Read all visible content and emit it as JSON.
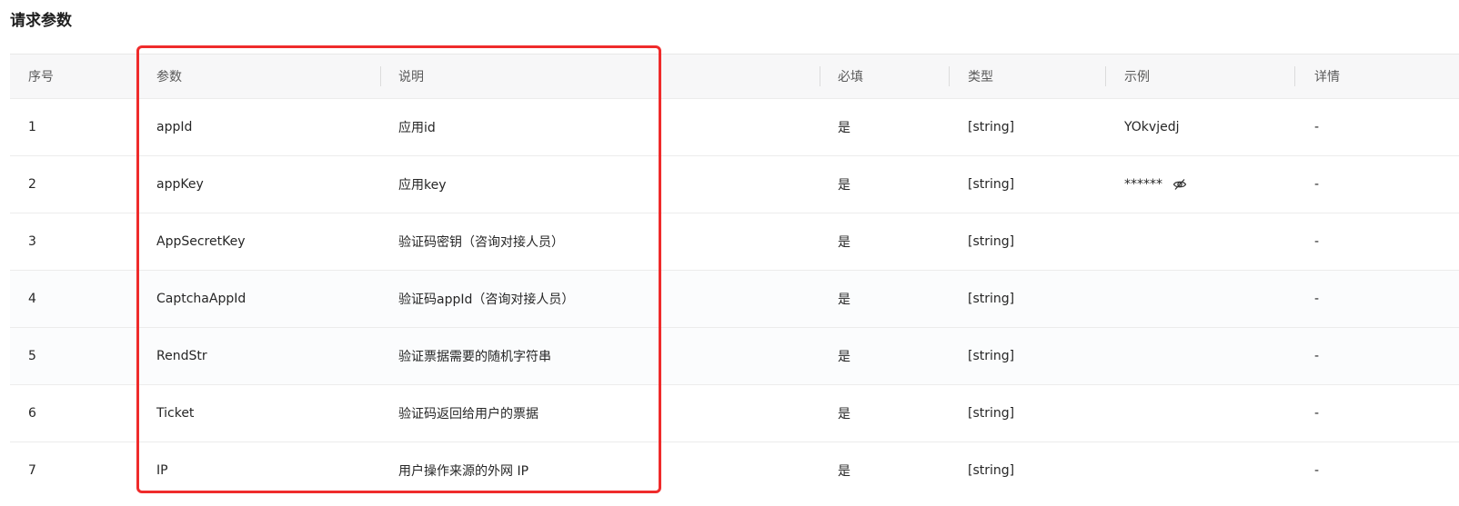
{
  "section_title": "请求参数",
  "table": {
    "headers": [
      "序号",
      "参数",
      "说明",
      "必填",
      "类型",
      "示例",
      "详情"
    ],
    "rows": [
      {
        "index": "1",
        "param": "appId",
        "desc": "应用id",
        "required": "是",
        "type": "[string]",
        "example": "YOkvjedj",
        "detail": "-"
      },
      {
        "index": "2",
        "param": "appKey",
        "desc": "应用key",
        "required": "是",
        "type": "[string]",
        "example": "******",
        "detail": "-"
      },
      {
        "index": "3",
        "param": "AppSecretKey",
        "desc": "验证码密钥（咨询对接人员）",
        "required": "是",
        "type": "[string]",
        "example": "",
        "detail": "-"
      },
      {
        "index": "4",
        "param": "CaptchaAppId",
        "desc": "验证码appId（咨询对接人员）",
        "required": "是",
        "type": "[string]",
        "example": "",
        "detail": "-"
      },
      {
        "index": "5",
        "param": "RendStr",
        "desc": "验证票据需要的随机字符串",
        "required": "是",
        "type": "[string]",
        "example": "",
        "detail": "-"
      },
      {
        "index": "6",
        "param": "Ticket",
        "desc": "验证码返回给用户的票据",
        "required": "是",
        "type": "[string]",
        "example": "",
        "detail": "-"
      },
      {
        "index": "7",
        "param": "IP",
        "desc": "用户操作来源的外网 IP",
        "required": "是",
        "type": "[string]",
        "example": "",
        "detail": "-"
      }
    ]
  },
  "icons": {
    "masked_value_toggle": "eye-off-icon"
  },
  "colors": {
    "highlight_border": "#ef2b2b",
    "header_bg": "#f7f7f8",
    "alt_row_bg": "#fbfcfd"
  }
}
